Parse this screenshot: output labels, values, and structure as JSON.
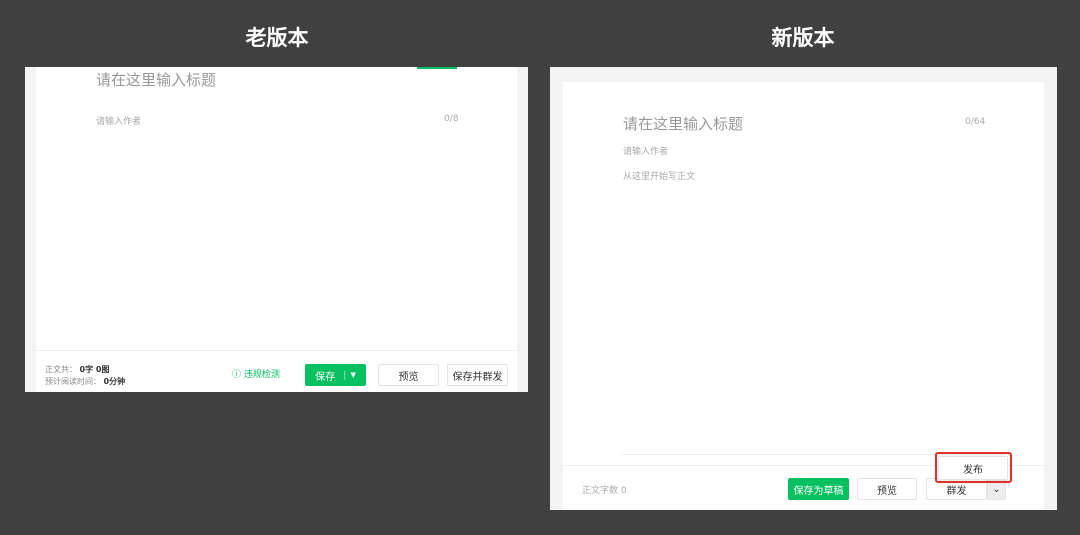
{
  "old": {
    "heading": "老版本",
    "title_placeholder": "请在这里输入标题",
    "author_placeholder": "请输入作者",
    "author_count": "0/8",
    "stats_label": "正文共：",
    "stats_value": "0字 0图",
    "read_label": "预计阅读时间：",
    "read_value": "0分钟",
    "check_label": "违规检测",
    "save_label": "保存",
    "preview_label": "预览",
    "save_send_label": "保存并群发"
  },
  "new": {
    "heading": "新版本",
    "title_placeholder": "请在这里输入标题",
    "title_count": "0/64",
    "author_placeholder": "请输入作者",
    "body_placeholder": "从这里开始写正文",
    "word_count_label": "正文字数",
    "word_count": "0",
    "draft_label": "保存为草稿",
    "preview_label": "预览",
    "mass_send_label": "群发",
    "publish_label": "发布"
  },
  "colors": {
    "accent": "#07c160",
    "highlight": "#e0302a",
    "background": "#404040"
  }
}
